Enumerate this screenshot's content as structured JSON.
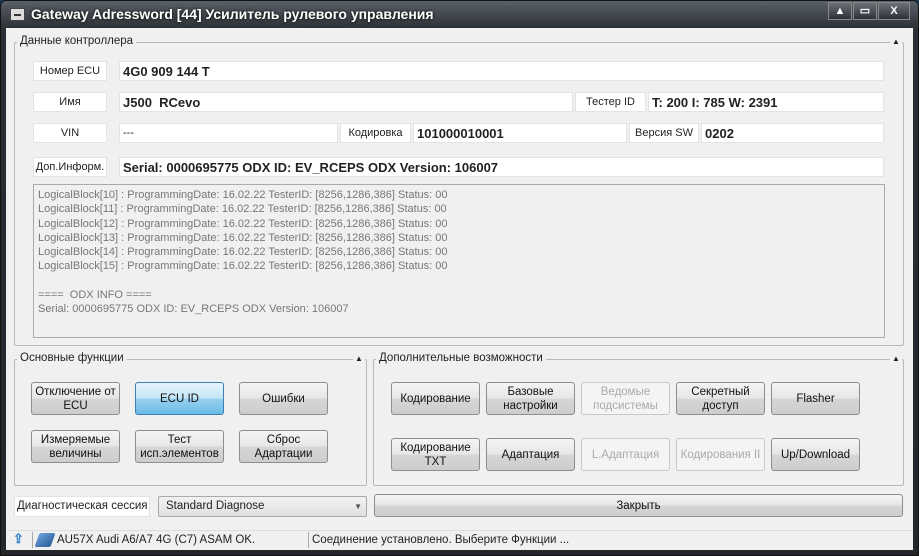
{
  "window": {
    "title": "Gateway Adressword [44] Усилитель рулевого управления",
    "min_icon": "▲",
    "max_icon": "▭",
    "close_icon": "X"
  },
  "controller": {
    "group_label": "Данные контроллера",
    "ecu_label": "Номер ECU",
    "ecu_value": "4G0 909 144 T",
    "name_label": "Имя",
    "name_value": "J500  RCevo",
    "tester_label": "Тестер ID",
    "tester_value": "T: 200 I: 785 W: 2391",
    "vin_label": "VIN",
    "vin_value": "---",
    "coding_label": "Кодировка",
    "coding_value": "101000010001",
    "sw_label": "Версия SW",
    "sw_value": "0202",
    "info_label": "Доп.Информ.",
    "info_value": "Serial: 0000695775 ODX ID: EV_RCEPS ODX Version: 106007",
    "log": "LogicalBlock[10] : ProgrammingDate: 16.02.22 TesterID: [8256,1286,386] Status: 00\nLogicalBlock[11] : ProgrammingDate: 16.02.22 TesterID: [8256,1286,386] Status: 00\nLogicalBlock[12] : ProgrammingDate: 16.02.22 TesterID: [8256,1286,386] Status: 00\nLogicalBlock[13] : ProgrammingDate: 16.02.22 TesterID: [8256,1286,386] Status: 00\nLogicalBlock[14] : ProgrammingDate: 16.02.22 TesterID: [8256,1286,386] Status: 00\nLogicalBlock[15] : ProgrammingDate: 16.02.22 TesterID: [8256,1286,386] Status: 00\n\n====  ODX INFO ====\nSerial: 0000695775 ODX ID: EV_RCEPS ODX Version: 106007"
  },
  "basic": {
    "group_label": "Основные функции",
    "buttons": [
      "Отключение от ECU",
      "ECU ID",
      "Ошибки",
      "Измеряемые величины",
      "Тест исп.элементов",
      "Сброс Адартации"
    ]
  },
  "extra": {
    "group_label": "Дополнительные возможности",
    "buttons": [
      "Кодирование",
      "Базовые настройки",
      "Ведомые подсистемы",
      "Секретный доступ",
      "Flasher",
      "Кодирование TXT",
      "Адаптация",
      "L.Адаптация",
      "Кодирования II",
      "Up/Download"
    ]
  },
  "session": {
    "label": "Диагностическая сессия",
    "value": "Standard Diagnose"
  },
  "close_label": "Закрыть",
  "status": {
    "car": "AU57X Audi A6/A7 4G (C7) ASAM OK.",
    "message": "Соединение установлено. Выберите Функции ..."
  }
}
